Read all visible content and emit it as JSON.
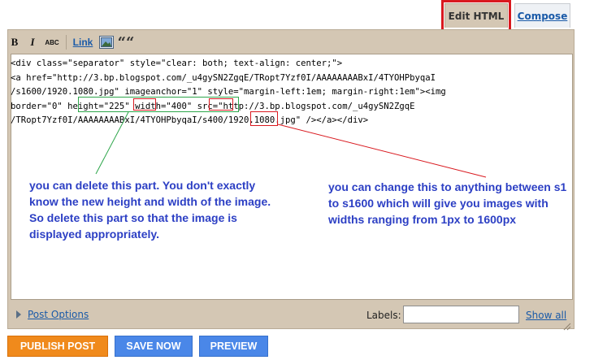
{
  "tabs": {
    "edit_html": "Edit HTML",
    "compose": "Compose"
  },
  "toolbar": {
    "bold": "B",
    "italic": "I",
    "strikethrough": "ABC",
    "link": "Link",
    "image_icon": "image-icon",
    "blockquote": "““"
  },
  "editor": {
    "lines": [
      "<div class=\"separator\" style=\"clear: both; text-align: center;\">",
      "<a href=\"http://3.bp.blogspot.com/_u4gySN2ZgqE/TRopt7Yzf0I/AAAAAAAABxI/4TYOHPbyqaI",
      "/s1600/1920.1080.jpg\" imageanchor=\"1\" style=\"margin-left:1em; margin-right:1em\"><img",
      "border=\"0\" height=\"225\" width=\"400\" src=\"http://3.bp.blogspot.com/_u4gySN2ZgqE",
      "/TRopt7Yzf0I/AAAAAAAABxI/4TYOHPbyqaI/s400/1920.1080.jpg\" /></a></div>"
    ]
  },
  "annotations": {
    "left_note": "you can delete this part. You don't exactly know the new height and width of the image. So delete this part so that the image is displayed appropriately.",
    "right_note": "you can change this to anything between s1 to s1600 which will give you images with widths ranging from 1px to 1600px"
  },
  "footer": {
    "post_options": "Post Options",
    "labels_label": "Labels:",
    "labels_value": "",
    "show_all": "Show all"
  },
  "actions": {
    "publish": "PUBLISH POST",
    "save": "SAVE NOW",
    "preview": "PREVIEW"
  },
  "colors": {
    "frame": "#d4c7b4",
    "publish": "#f08a1c",
    "save_preview": "#4a87e8",
    "annotation_text": "#2c3fc4",
    "highlight_red": "#d9191f",
    "highlight_green": "#2ea64b"
  }
}
